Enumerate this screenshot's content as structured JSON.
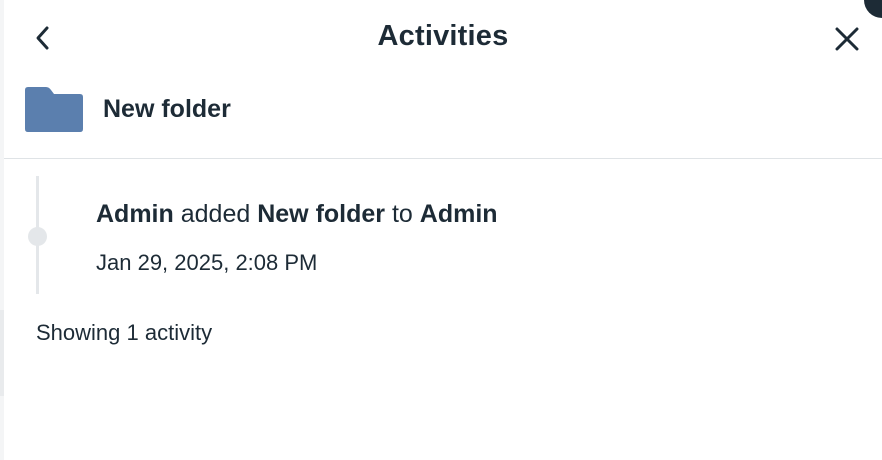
{
  "header": {
    "title": "Activities",
    "back_icon": "chevron-left-icon",
    "close_icon": "close-icon"
  },
  "item": {
    "icon": "folder-icon",
    "icon_color": "#5b7fae",
    "name": "New folder"
  },
  "activities": [
    {
      "actor": "Admin",
      "verb": "added",
      "object": "New folder",
      "preposition": "to",
      "target": "Admin",
      "timestamp": "Jan 29, 2025, 2:08 PM"
    }
  ],
  "summary": "Showing 1 activity",
  "colors": {
    "text": "#1d2b36",
    "divider": "#dfe3e6",
    "timeline": "#e4e7ea"
  }
}
